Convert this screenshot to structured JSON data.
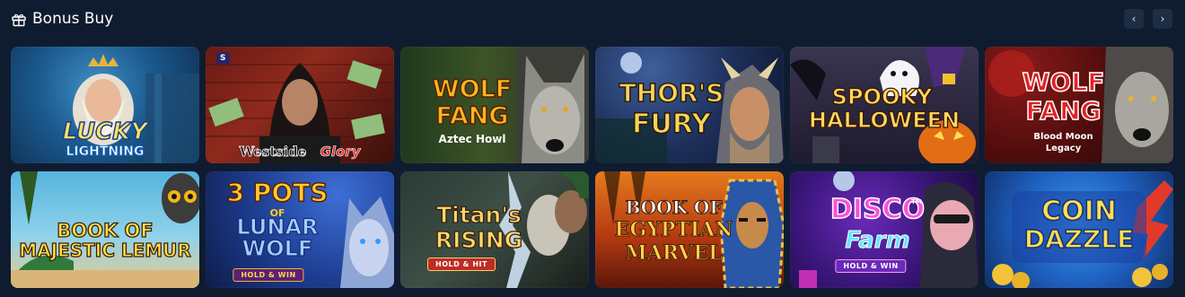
{
  "section": {
    "title": "Bonus Buy",
    "icon": "gift-icon",
    "prev_label": "‹",
    "next_label": "›"
  },
  "games": [
    {
      "title": "Lucky",
      "title2": "Lightning"
    },
    {
      "title": "Westside",
      "title2": "Glory",
      "provider_badge": "S"
    },
    {
      "title": "Wolf",
      "title2": "Fang",
      "subtitle": "Aztec Howl"
    },
    {
      "title": "Thor's",
      "title2": "Fury"
    },
    {
      "title": "Spooky",
      "title2": "Halloween"
    },
    {
      "title": "Wolf",
      "title2": "Fang",
      "subtitle": "Blood Moon",
      "subtitle2": "Legacy"
    },
    {
      "title": "Book of",
      "title2": "Majestic Lemur"
    },
    {
      "title": "3 Pots",
      "title_of": "of",
      "title2": "Lunar",
      "title3": "Wolf",
      "badge": "HOLD & WIN"
    },
    {
      "title": "Titan's",
      "title2": "Rising",
      "badge": "HOLD & HIT"
    },
    {
      "title": "Book of",
      "title2": "Egyptian",
      "title3": "Marvel"
    },
    {
      "title": "Disco",
      "title2": "Farm",
      "badge": "HOLD & WIN",
      "tm": "TM"
    },
    {
      "title": "Coin",
      "title2": "Dazzle"
    }
  ]
}
